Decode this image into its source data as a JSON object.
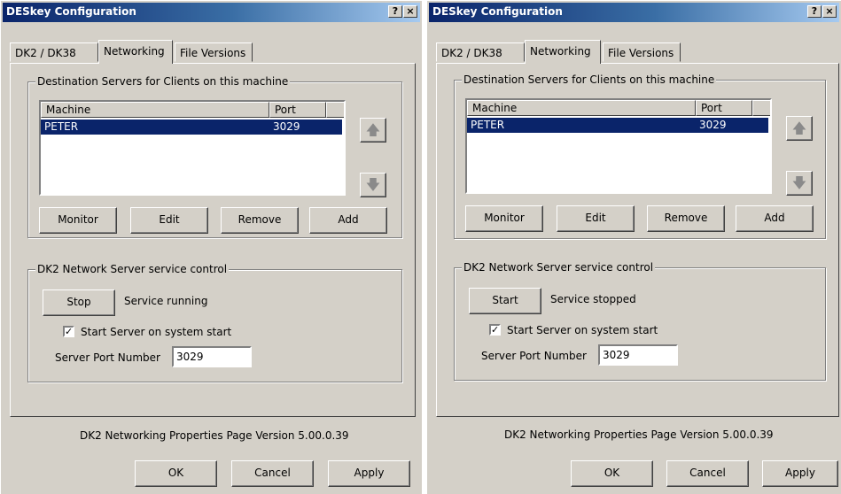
{
  "dialogs": [
    {
      "title": "DESkey Configuration",
      "title_buttons": {
        "help": "?",
        "close": "×"
      },
      "tabs": [
        "DK2 / DK38",
        "Networking",
        "File Versions"
      ],
      "destination_group": {
        "legend": "Destination Servers for Clients on this machine",
        "columns": [
          "Machine",
          "Port"
        ],
        "rows": [
          {
            "machine": "PETER",
            "port": "3029"
          }
        ],
        "buttons": {
          "monitor": "Monitor",
          "edit": "Edit",
          "remove": "Remove",
          "add": "Add"
        },
        "arrow_up": "🡅",
        "arrow_down": "🡇"
      },
      "service_group": {
        "legend": "DK2 Network Server service control",
        "action_button": "Stop",
        "status": "Service running",
        "checkbox_label": "Start Server on system start",
        "checkbox_checked": true,
        "checkbox_mark": "✓",
        "port_label": "Server Port Number",
        "port_value": "3029"
      },
      "version_text": "DK2 Networking Properties Page Version 5.00.0.39",
      "footer": {
        "ok": "OK",
        "cancel": "Cancel",
        "apply": "Apply"
      }
    },
    {
      "title": "DESkey Configuration",
      "title_buttons": {
        "help": "?",
        "close": "×"
      },
      "tabs": [
        "DK2 / DK38",
        "Networking",
        "File Versions"
      ],
      "destination_group": {
        "legend": "Destination Servers for Clients on this machine",
        "columns": [
          "Machine",
          "Port"
        ],
        "rows": [
          {
            "machine": "PETER",
            "port": "3029"
          }
        ],
        "buttons": {
          "monitor": "Monitor",
          "edit": "Edit",
          "remove": "Remove",
          "add": "Add"
        },
        "arrow_up": "🡅",
        "arrow_down": "🡇"
      },
      "service_group": {
        "legend": "DK2 Network Server service control",
        "action_button": "Start",
        "status": "Service stopped",
        "checkbox_label": "Start Server on system start",
        "checkbox_checked": true,
        "checkbox_mark": "✓",
        "port_label": "Server Port Number",
        "port_value": "3029"
      },
      "version_text": "DK2 Networking Properties Page Version 5.00.0.39",
      "footer": {
        "ok": "OK",
        "cancel": "Cancel",
        "apply": "Apply"
      }
    }
  ],
  "colors": {
    "face": "#d4d0c8",
    "title_start": "#0a246a",
    "title_end": "#a6caf0",
    "selection": "#0a246a"
  }
}
